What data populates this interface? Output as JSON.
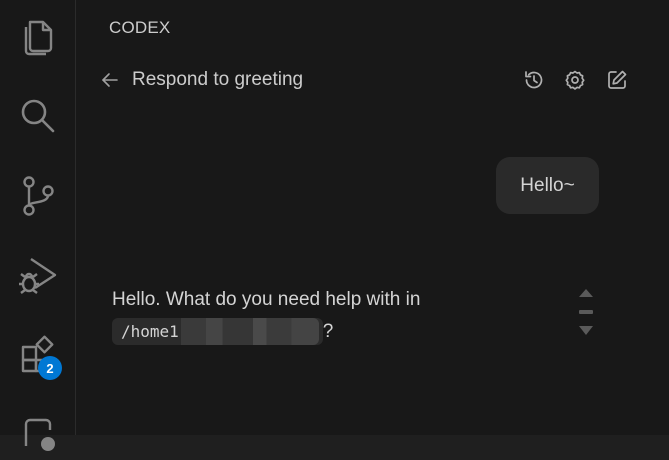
{
  "activity_bar": {
    "items": [
      {
        "icon": "files-icon"
      },
      {
        "icon": "search-icon"
      },
      {
        "icon": "source-control-icon"
      },
      {
        "icon": "run-debug-icon"
      },
      {
        "icon": "extensions-icon"
      },
      {
        "icon": "codex-icon"
      }
    ],
    "extensions_badge": "2"
  },
  "panel": {
    "title": "CODEX",
    "conversation_title": "Respond to greeting",
    "header_icons": [
      "history-icon",
      "settings-icon",
      "new-chat-icon"
    ]
  },
  "messages": {
    "user": "Hello~",
    "assistant_text": "Hello. What do you need help with in",
    "assistant_path": "/home1",
    "assistant_suffix": "?"
  },
  "colors": {
    "background": "#181818",
    "activity_bar": "#181818",
    "bubble": "#2a2a2a",
    "badge": "#0078d4"
  }
}
